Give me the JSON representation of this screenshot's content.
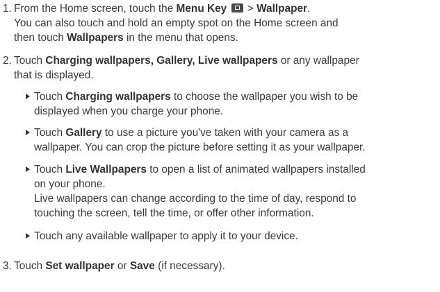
{
  "step1": {
    "number": "1.",
    "line1_pre": "From the Home screen, touch the ",
    "menu_key": "Menu Key",
    "icon": "menu-key-icon",
    "line1_gt": " > ",
    "wallpaper": "Wallpaper",
    "line1_end": ".",
    "line2": "You can also touch and hold an empty spot on the Home screen and",
    "line3_pre": "then touch ",
    "wallpapers": "Wallpapers",
    "line3_post": " in the menu that opens."
  },
  "step2": {
    "number": "2.",
    "line1_pre": "Touch ",
    "line1_bold": "Charging wallpapers, Gallery, Live wallpapers",
    "line1_post": " or any wallpaper",
    "line2": "that is displayed."
  },
  "bullets": [
    {
      "lead": "Touch ",
      "bold": "Charging wallpapers",
      "rest_line1": " to choose the wallpaper you wish to be",
      "lines": [
        "displayed when you charge your phone."
      ]
    },
    {
      "lead": "Touch ",
      "bold": "Gallery",
      "rest_line1": " to use a picture you've taken with your camera as a",
      "lines": [
        "wallpaper. You can crop the picture before setting it as your wallpaper."
      ]
    },
    {
      "lead": "Touch ",
      "bold": "Live Wallpapers",
      "rest_line1": " to open a list of animated wallpapers installed",
      "lines": [
        "on your phone.",
        "Live wallpapers can change according to the time of day, respond to",
        "touching the screen, tell the time, or offer other information."
      ]
    },
    {
      "lead": "Touch any available wallpaper to apply it to your device.",
      "bold": "",
      "rest_line1": "",
      "lines": []
    }
  ],
  "step3": {
    "number": "3.",
    "pre": "Touch ",
    "set_wallpaper": "Set wallpaper",
    "or": " or ",
    "save": "Save",
    "post": " (if necessary)."
  }
}
